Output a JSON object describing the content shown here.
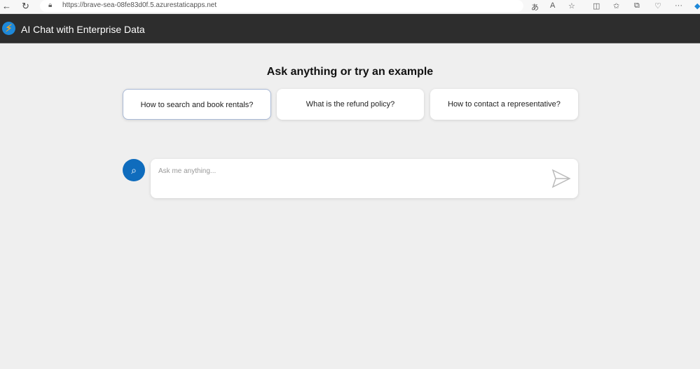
{
  "browser": {
    "url": "https://brave-sea-08fe83d0f.5.azurestaticapps.net"
  },
  "header": {
    "title": "AI Chat with Enterprise Data"
  },
  "main": {
    "heading": "Ask anything or try an example",
    "examples": [
      {
        "label": "How to search and book rentals?"
      },
      {
        "label": "What is the refund policy?"
      },
      {
        "label": "How to contact a representative?"
      }
    ],
    "input": {
      "placeholder": "Ask me anything...",
      "value": ""
    }
  },
  "colors": {
    "header": "#2d2d2d",
    "accent": "#0f6cbd"
  }
}
